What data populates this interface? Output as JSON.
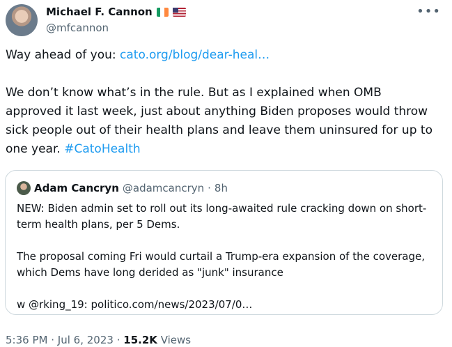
{
  "author": {
    "display_name": "Michael F. Cannon",
    "handle": "@mfcannon",
    "flags": [
      "ireland-flag",
      "us-flag"
    ]
  },
  "tweet": {
    "intro": "Way ahead of you: ",
    "link": "cato.org/blog/dear-heal…",
    "body": "We don’t know what’s in the rule. But as I explained when OMB approved it last week, just about anything Biden proposes would throw sick people out of their health plans and leave them uninsured for up to one year. ",
    "hashtag": "#CatoHealth"
  },
  "quote": {
    "display_name": "Adam Cancryn",
    "handle": "@adamcancryn",
    "separator": "·",
    "time": "8h",
    "text": "NEW: Biden admin set to roll out its long-awaited rule cracking down on short-term health plans, per 5 Dems.\n\nThe proposal coming Fri would curtail a Trump-era expansion of the coverage, which Dems have long derided as \"junk\" insurance\n\nw @rking_19: politico.com/news/2023/07/0…"
  },
  "meta": {
    "time": "5:36 PM",
    "sep1": "·",
    "date": "Jul 6, 2023",
    "sep2": "·",
    "views_count": "15.2K",
    "views_label": "Views"
  },
  "more_label": "•••",
  "colors": {
    "link": "#1d9bf0",
    "text": "#0f1419",
    "secondary": "#536471",
    "border": "#cfd9de"
  }
}
